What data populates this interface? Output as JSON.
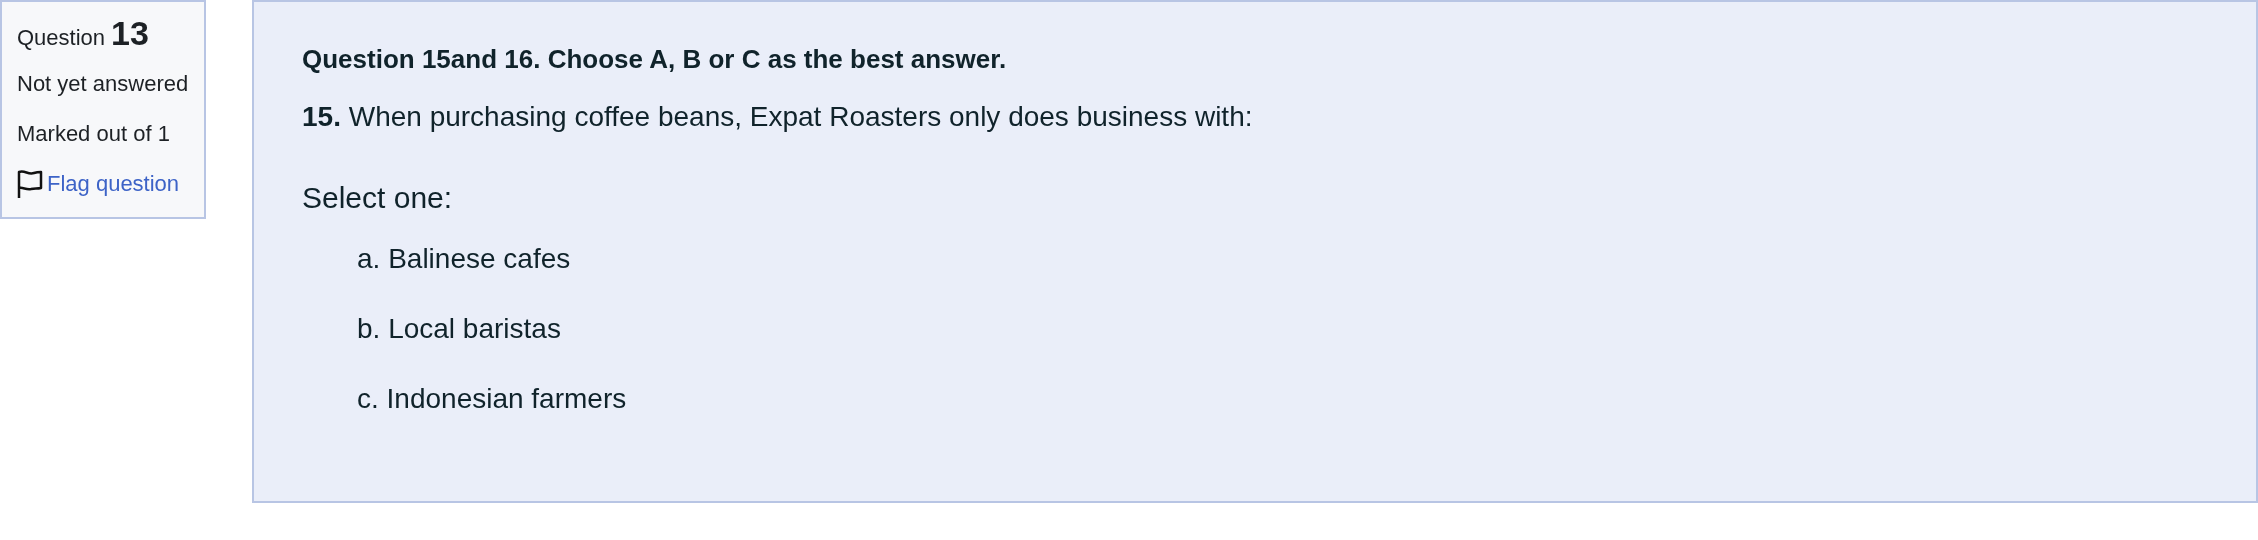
{
  "info": {
    "label": "Question",
    "number": "13",
    "status": "Not yet answered",
    "marks": "Marked out of 1",
    "flag_link": "Flag question"
  },
  "question": {
    "instruction": "Question 15and 16. Choose A, B or C as the best answer.",
    "number": "15.",
    "text": "When purchasing coffee beans, Expat Roasters only does business with:",
    "prompt": "Select one:",
    "options": [
      {
        "letter": "a.",
        "text": "Balinese cafes"
      },
      {
        "letter": "b.",
        "text": "Local baristas"
      },
      {
        "letter": "c.",
        "text": "Indonesian farmers"
      }
    ]
  }
}
